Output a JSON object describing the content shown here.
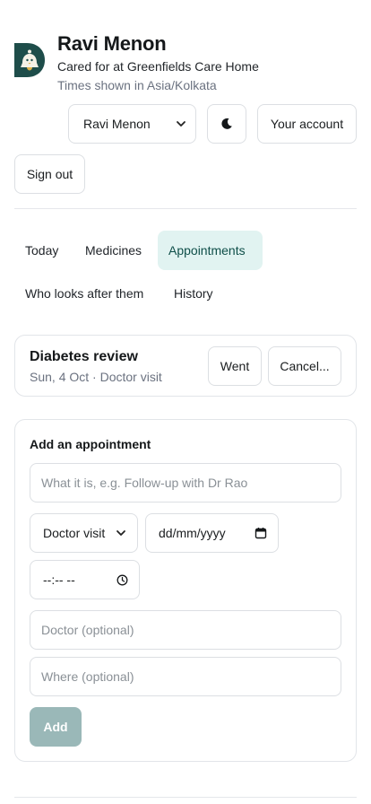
{
  "header": {
    "title": "Ravi Menon",
    "subtitle": "Cared for at Greenfields Care Home",
    "timezone_note": "Times shown in Asia/Kolkata"
  },
  "controls": {
    "person_select_value": "Ravi Menon",
    "account_label": "Your account",
    "sign_out_label": "Sign out"
  },
  "tabs": [
    {
      "label": "Today",
      "active": false
    },
    {
      "label": "Medicines",
      "active": false
    },
    {
      "label": "Appointments",
      "active": true
    },
    {
      "label": "Who looks after them",
      "active": false
    },
    {
      "label": "History",
      "active": false
    }
  ],
  "appointment": {
    "title": "Diabetes review",
    "meta": "Sun, 4 Oct · Doctor visit",
    "went_label": "Went",
    "cancel_label": "Cancel..."
  },
  "add_form": {
    "heading": "Add an appointment",
    "what_placeholder": "What it is, e.g. Follow-up with Dr Rao",
    "type_value": "Doctor visit",
    "date_value": "dd/mm/yyyy",
    "time_value": "--:-- --",
    "doctor_placeholder": "Doctor (optional)",
    "where_placeholder": "Where (optional)",
    "add_label": "Add"
  },
  "colors": {
    "brand": "#1e4d4a",
    "active_tab_bg": "#e1f3f1",
    "disabled_button": "#9ab8b8"
  }
}
